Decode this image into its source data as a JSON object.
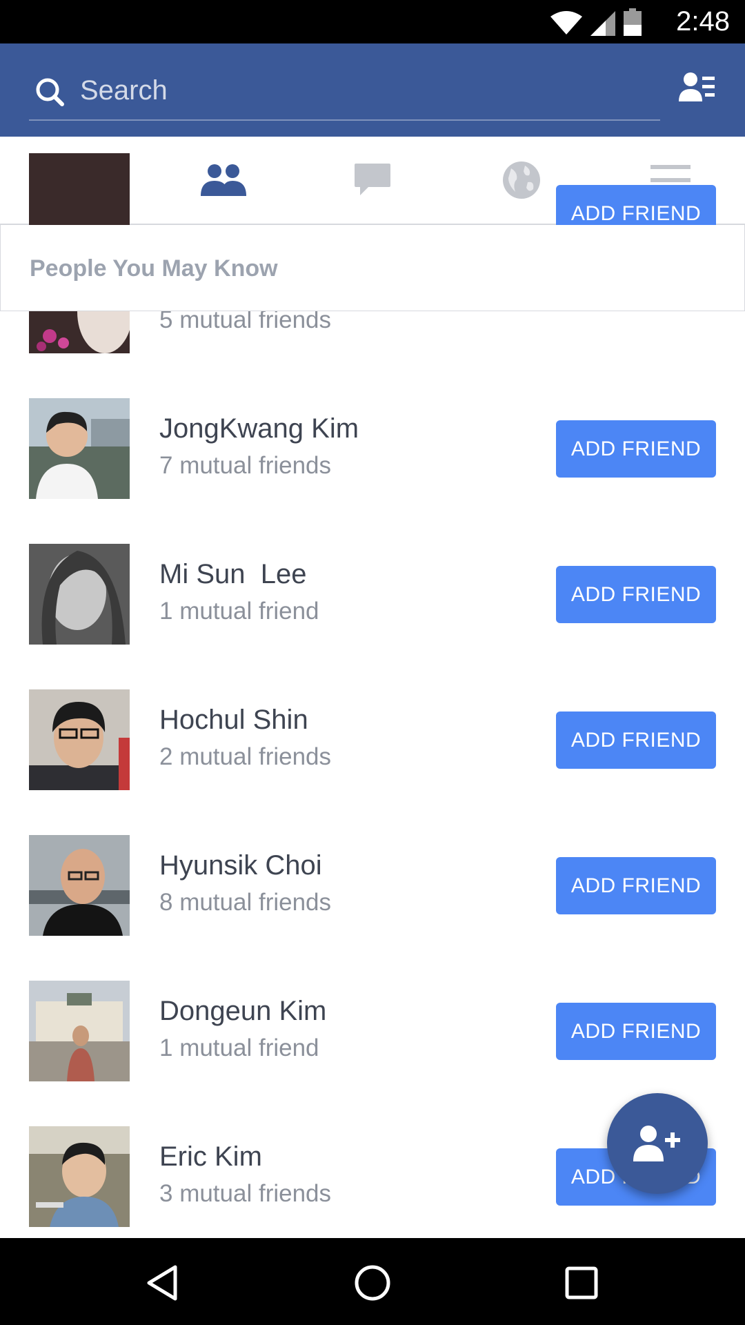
{
  "status_bar": {
    "time": "2:48"
  },
  "search": {
    "placeholder": "Search"
  },
  "tabs": [
    {
      "name": "news-feed",
      "icon": "news-feed-icon",
      "active": false
    },
    {
      "name": "friends",
      "icon": "friends-icon",
      "active": true
    },
    {
      "name": "messages",
      "icon": "chat-icon",
      "active": false
    },
    {
      "name": "notifications",
      "icon": "globe-icon",
      "active": false
    },
    {
      "name": "more",
      "icon": "menu-icon",
      "active": false
    }
  ],
  "section": {
    "title": "People You May Know"
  },
  "people": [
    {
      "name": "",
      "mutual": "5 mutual friends",
      "button": "ADD FRIEND"
    },
    {
      "name": "JongKwang Kim",
      "mutual": "7 mutual friends",
      "button": "ADD FRIEND"
    },
    {
      "name": "Mi Sun  Lee",
      "mutual": "1 mutual friend",
      "button": "ADD FRIEND"
    },
    {
      "name": "Hochul Shin",
      "mutual": "2 mutual friends",
      "button": "ADD FRIEND"
    },
    {
      "name": "Hyunsik Choi",
      "mutual": "8 mutual friends",
      "button": "ADD FRIEND"
    },
    {
      "name": "Dongeun Kim",
      "mutual": "1 mutual friend",
      "button": "ADD FRIEND"
    },
    {
      "name": "Eric Kim",
      "mutual": "3 mutual friends",
      "button": "ADD FRIEND"
    }
  ],
  "colors": {
    "brand_blue": "#3b5998",
    "button_blue": "#4c86f5",
    "inactive_icon": "#c3c6cc"
  },
  "fab": {
    "icon": "add-person-icon"
  }
}
